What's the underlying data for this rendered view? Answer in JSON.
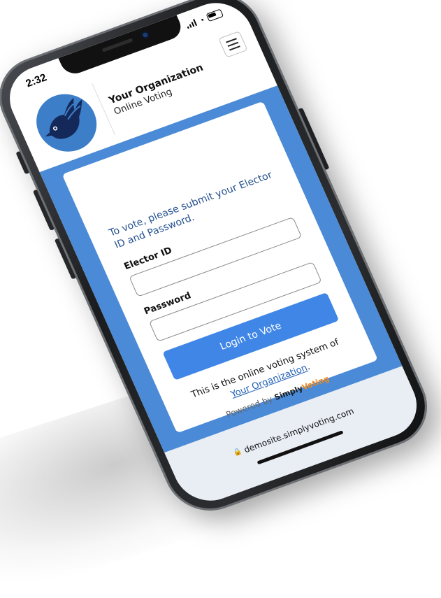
{
  "status_bar": {
    "time": "2:32"
  },
  "header": {
    "org_name": "Your Organization",
    "org_subtitle": "Online Voting",
    "logo_icon": "bird-logo-icon",
    "menu_icon": "hamburger-menu-icon"
  },
  "login": {
    "intro": "To vote, please submit your Elector ID and Password.",
    "elector_label": "Elector ID",
    "elector_value": "",
    "password_label": "Password",
    "password_value": "",
    "submit_label": "Login to Vote"
  },
  "footer": {
    "system_text": "This is the online voting system of",
    "org_link": "Your Organization",
    "period": ".",
    "powered_by": "Powered by",
    "brand_part1": "Simply",
    "brand_part2": "Voting"
  },
  "browser": {
    "url": "demosite.simplyvoting.com"
  },
  "colors": {
    "page_blue": "#4a8ad6",
    "button_blue": "#3f86e6",
    "intro_text": "#24518f",
    "brand_orange": "#f08a1c"
  }
}
